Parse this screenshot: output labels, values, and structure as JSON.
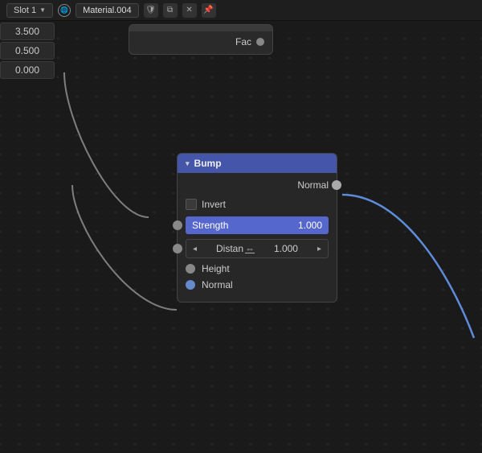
{
  "topbar": {
    "slot_label": "Slot 1",
    "material_name": "Material.004",
    "icons": [
      "shield",
      "copy",
      "x",
      "pin"
    ]
  },
  "left_panel": {
    "values": [
      "3.500",
      "0.500",
      "0.000"
    ]
  },
  "node_fac": {
    "output_label": "Fac"
  },
  "node_bump": {
    "title": "Bump",
    "output_normal_label": "Normal",
    "invert_label": "Invert",
    "strength_label": "Strength",
    "strength_value": "1.000",
    "distance_label": "Distance",
    "distance_value": "1.000",
    "height_label": "Height",
    "normal_label": "Normal"
  },
  "colors": {
    "node_header": "#4455aa",
    "socket_gray": "#888888",
    "socket_blue": "#6688cc",
    "socket_purple": "#9966cc",
    "field_blue": "#5566cc",
    "curve_gray": "#aaaaaa",
    "curve_blue": "#6699ee"
  }
}
